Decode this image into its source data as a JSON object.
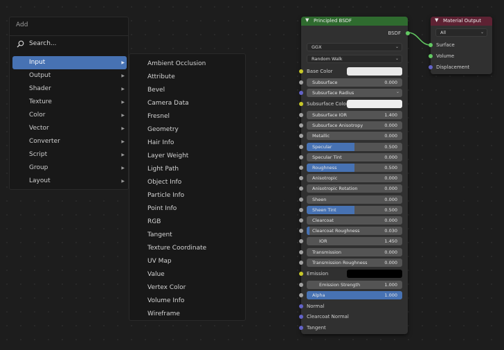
{
  "add_menu": {
    "title": "Add",
    "search_label": "Search...",
    "categories": [
      {
        "label": "Input",
        "active": true
      },
      {
        "label": "Output"
      },
      {
        "label": "Shader"
      },
      {
        "label": "Texture"
      },
      {
        "label": "Color"
      },
      {
        "label": "Vector"
      },
      {
        "label": "Converter"
      },
      {
        "label": "Script"
      },
      {
        "label": "Group"
      },
      {
        "label": "Layout"
      }
    ]
  },
  "input_submenu": {
    "items": [
      "Ambient Occlusion",
      "Attribute",
      "Bevel",
      "Camera Data",
      "Fresnel",
      "Geometry",
      "Hair Info",
      "Layer Weight",
      "Light Path",
      "Object Info",
      "Particle Info",
      "Point Info",
      "RGB",
      "Tangent",
      "Texture Coordinate",
      "UV Map",
      "Value",
      "Vertex Color",
      "Volume Info",
      "Wireframe"
    ]
  },
  "bsdf_node": {
    "title": "Principled BSDF",
    "output_label": "BSDF",
    "distribution": "GGX",
    "subsurface_method": "Random Walk",
    "base_color_label": "Base Color",
    "base_color": "#e9e9e9",
    "subsurface": {
      "label": "Subsurface",
      "value": "0.000"
    },
    "subsurface_radius_label": "Subsurface Radius",
    "subsurface_color_label": "Subsurface Color",
    "subsurface_color": "#eeeeee",
    "sliders": [
      {
        "label": "Subsurface IOR",
        "value": "1.400",
        "fill": 0.0
      },
      {
        "label": "Subsurface Anisotropy",
        "value": "0.000",
        "fill": 0.0
      },
      {
        "label": "Metallic",
        "value": "0.000",
        "fill": 0.0
      },
      {
        "label": "Specular",
        "value": "0.500",
        "fill": 0.5
      },
      {
        "label": "Specular Tint",
        "value": "0.000",
        "fill": 0.0
      },
      {
        "label": "Roughness",
        "value": "0.500",
        "fill": 0.5
      },
      {
        "label": "Anisotropic",
        "value": "0.000",
        "fill": 0.0
      },
      {
        "label": "Anisotropic Rotation",
        "value": "0.000",
        "fill": 0.0
      },
      {
        "label": "Sheen",
        "value": "0.000",
        "fill": 0.0
      },
      {
        "label": "Sheen Tint",
        "value": "0.500",
        "fill": 0.5
      },
      {
        "label": "Clearcoat",
        "value": "0.000",
        "fill": 0.0
      },
      {
        "label": "Clearcoat Roughness",
        "value": "0.030",
        "fill": 0.03
      },
      {
        "label": "IOR",
        "value": "1.450",
        "fill": 0.0
      },
      {
        "label": "Transmission",
        "value": "0.000",
        "fill": 0.0
      },
      {
        "label": "Transmission Roughness",
        "value": "0.000",
        "fill": 0.0
      }
    ],
    "emission_label": "Emission",
    "emission_color": "#000000",
    "emission_strength": {
      "label": "Emission Strength",
      "value": "1.000"
    },
    "alpha": {
      "label": "Alpha",
      "value": "1.000",
      "fill": 1.0
    },
    "vector_inputs": [
      "Normal",
      "Clearcoat Normal",
      "Tangent"
    ]
  },
  "output_node": {
    "title": "Material Output",
    "target": "All",
    "inputs": [
      "Surface",
      "Volume",
      "Displacement"
    ]
  },
  "colors": {
    "accent": "#4772b3",
    "bsdf_header": "#2f6b2f",
    "output_header": "#5e2233",
    "socket_color": "#c7c729",
    "socket_float": "#a1a1a1",
    "socket_vector": "#6363c7",
    "socket_shader": "#62c862"
  }
}
